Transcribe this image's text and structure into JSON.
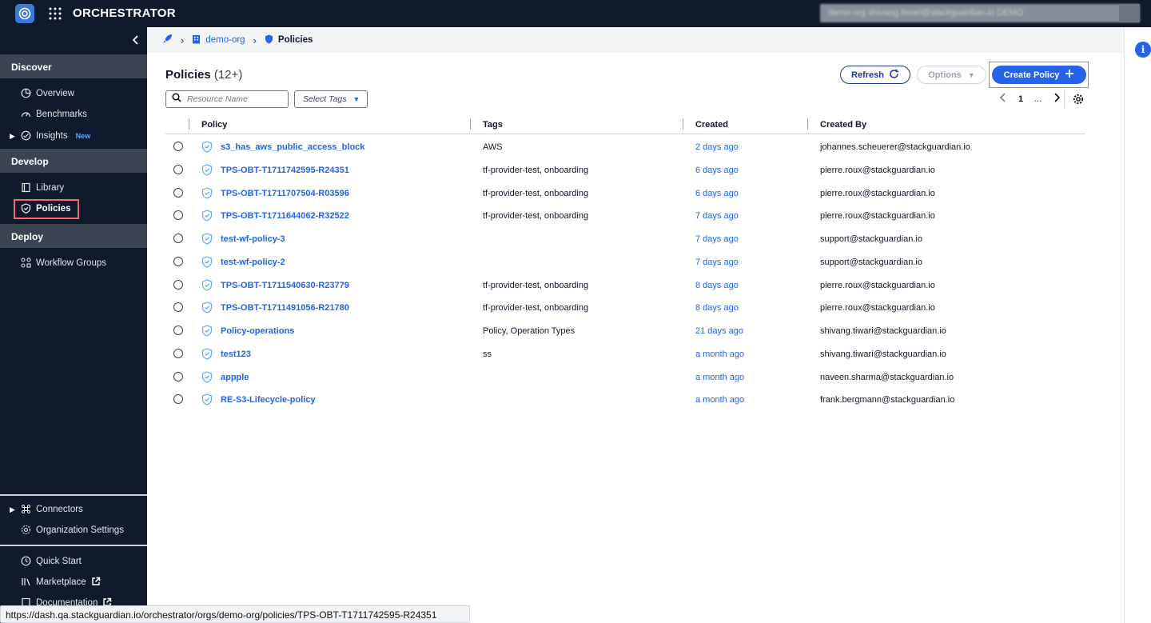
{
  "app": {
    "brand": "ORCHESTRATOR",
    "user_blurred": "demo-org  shivang.tiwari@stackguardian.io  DEMO"
  },
  "sidebar": {
    "sections": {
      "discover": "Discover",
      "develop": "Develop",
      "deploy": "Deploy"
    },
    "items": {
      "overview": "Overview",
      "benchmarks": "Benchmarks",
      "insights": "Insights",
      "insights_badge": "New",
      "library": "Library",
      "policies": "Policies",
      "workflow_groups": "Workflow Groups",
      "connectors": "Connectors",
      "org_settings": "Organization Settings",
      "quick_start": "Quick Start",
      "marketplace": "Marketplace",
      "documentation": "Documentation"
    }
  },
  "breadcrumb": {
    "org": "demo-org",
    "current": "Policies"
  },
  "page": {
    "title": "Policies",
    "count": "(12+)",
    "refresh_label": "Refresh",
    "options_label": "Options",
    "create_label": "Create Policy",
    "search_placeholder": "Resource Name",
    "tags_label": "Select Tags",
    "page_number": "1",
    "page_ellipsis": "..."
  },
  "table": {
    "columns": [
      "Policy",
      "Tags",
      "Created",
      "Created By"
    ],
    "rows": [
      {
        "name": "s3_has_aws_public_access_block",
        "tags": "AWS",
        "created": "2 days ago",
        "created_by": "johannes.scheuerer@stackguardian.io"
      },
      {
        "name": "TPS-OBT-T1711742595-R24351",
        "tags": "tf-provider-test, onboarding",
        "created": "6 days ago",
        "created_by": "pierre.roux@stackguardian.io"
      },
      {
        "name": "TPS-OBT-T1711707504-R03596",
        "tags": "tf-provider-test, onboarding",
        "created": "6 days ago",
        "created_by": "pierre.roux@stackguardian.io"
      },
      {
        "name": "TPS-OBT-T1711644062-R32522",
        "tags": "tf-provider-test, onboarding",
        "created": "7 days ago",
        "created_by": "pierre.roux@stackguardian.io"
      },
      {
        "name": "test-wf-policy-3",
        "tags": "",
        "created": "7 days ago",
        "created_by": "support@stackguardian.io"
      },
      {
        "name": "test-wf-policy-2",
        "tags": "",
        "created": "7 days ago",
        "created_by": "support@stackguardian.io"
      },
      {
        "name": "TPS-OBT-T1711540630-R23779",
        "tags": "tf-provider-test, onboarding",
        "created": "8 days ago",
        "created_by": "pierre.roux@stackguardian.io"
      },
      {
        "name": "TPS-OBT-T1711491056-R21780",
        "tags": "tf-provider-test, onboarding",
        "created": "8 days ago",
        "created_by": "pierre.roux@stackguardian.io"
      },
      {
        "name": "Policy-operations",
        "tags": "Policy, Operation Types",
        "created": "21 days ago",
        "created_by": "shivang.tiwari@stackguardian.io"
      },
      {
        "name": "test123",
        "tags": "ss",
        "created": "a month ago",
        "created_by": "shivang.tiwari@stackguardian.io"
      },
      {
        "name": "appple",
        "tags": "",
        "created": "a month ago",
        "created_by": "naveen.sharma@stackguardian.io"
      },
      {
        "name": "RE-S3-Lifecycle-policy",
        "tags": "",
        "created": "a month ago",
        "created_by": "frank.bergmann@stackguardian.io"
      }
    ]
  },
  "statusbar": {
    "url": "https://dash.qa.stackguardian.io/orchestrator/orgs/demo-org/policies/TPS-OBT-T1711742595-R24351"
  },
  "icons": {
    "info": "i"
  },
  "colors": {
    "accent": "#2563eb",
    "sidebar_bg": "#0f1b2d",
    "section_bg": "#3b4453",
    "highlight": "#ef6b6b"
  }
}
